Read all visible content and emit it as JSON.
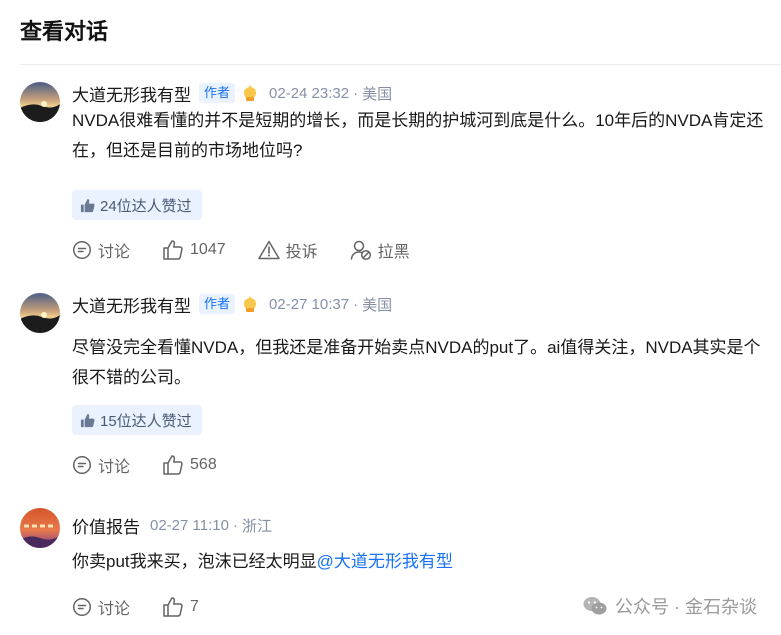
{
  "page": {
    "title": "查看对话"
  },
  "comments": [
    {
      "author": "大道无形我有型",
      "badge": "作者",
      "time": "02-24 23:32",
      "separator": "·",
      "location": "美国",
      "content": "NVDA很难看懂的并不是短期的增长，而是长期的护城河到底是什么。10年后的NVDA肯定还在，但还是目前的市场地位吗?",
      "likes_pill": "24位达人赞过",
      "actions": {
        "discuss": "讨论",
        "likes": "1047",
        "report": "投诉",
        "block": "拉黑"
      }
    },
    {
      "author": "大道无形我有型",
      "badge": "作者",
      "time": "02-27 10:37",
      "separator": "·",
      "location": "美国",
      "content": "尽管没完全看懂NVDA，但我还是准备开始卖点NVDA的put了。ai值得关注，NVDA其实是个很不错的公司。",
      "likes_pill": "15位达人赞过",
      "actions": {
        "discuss": "讨论",
        "likes": "568"
      }
    },
    {
      "author": "价值报告",
      "time": "02-27 11:10",
      "separator": "·",
      "location": "浙江",
      "content_prefix": "你卖put我来买，泡沫已经太明显",
      "mention": "@大道无形我有型",
      "actions": {
        "discuss": "讨论",
        "likes": "7"
      }
    }
  ],
  "watermark": {
    "text": "公众号 · 金石杂谈"
  },
  "colors": {
    "accent": "#1772f6",
    "muted": "#8590a6",
    "pill_bg": "#eaf2ff"
  }
}
